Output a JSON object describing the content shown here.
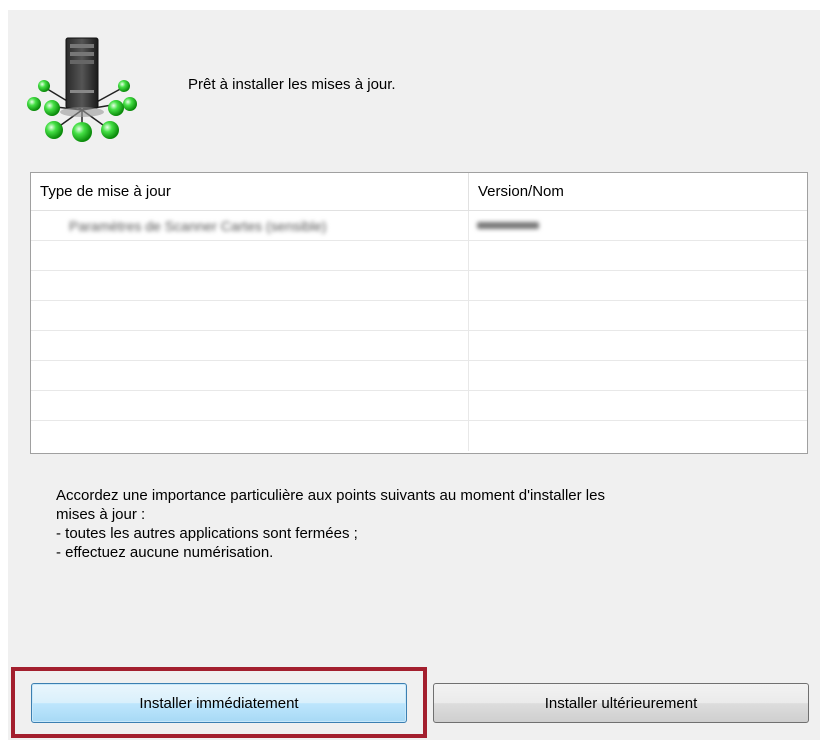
{
  "header": {
    "message": "Prêt à installer les mises à jour."
  },
  "table": {
    "columns": [
      "Type de mise à jour",
      "Version/Nom"
    ],
    "rows": [
      {
        "type": "Paramètres de Scanner Cartes (sensible)",
        "version": ""
      }
    ],
    "empty_row_count": 7
  },
  "info": {
    "lines": [
      "Accordez une importance particulière aux points suivants au moment d'installer les",
      "mises à jour :",
      "- toutes les autres applications sont fermées ;",
      "- effectuez aucune numérisation."
    ]
  },
  "buttons": {
    "install_now": "Installer immédiatement",
    "install_later": "Installer ultérieurement"
  },
  "icons": {
    "app_icon": "server-network-icon"
  },
  "colors": {
    "highlight": "#a31f2e",
    "node_green": "#33cc33"
  }
}
